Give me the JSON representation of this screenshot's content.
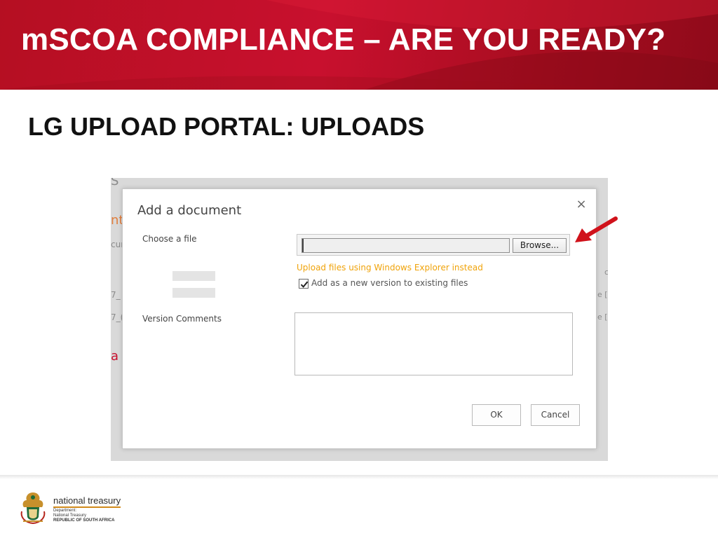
{
  "slide": {
    "title": "mSCOA COMPLIANCE – ARE YOU READY?",
    "subtitle": "LG UPLOAD PORTAL: UPLOADS"
  },
  "background_fragments": {
    "top": "S",
    "orange": "nt",
    "row1": "cur",
    "row2": "7_",
    "row3": "7_(",
    "red": "a",
    "right1": "c",
    "right2": "e [",
    "right3": "e ["
  },
  "dialog": {
    "title": "Add a document",
    "close_symbol": "×",
    "choose_file_label": "Choose a file",
    "file_input_value": "",
    "browse_label": "Browse...",
    "explorer_link": "Upload files using Windows Explorer instead",
    "version_checkbox_label": "Add as a new version to existing files",
    "version_checkbox_checked": true,
    "version_comments_label": "Version Comments",
    "version_comments_value": "",
    "ok_label": "OK",
    "cancel_label": "Cancel"
  },
  "footer": {
    "brand": "national treasury",
    "line1": "Department:",
    "line2": "National Treasury",
    "line3": "REPUBLIC OF SOUTH AFRICA"
  },
  "colors": {
    "banner_red": "#c8102e",
    "link_orange": "#f0a30a",
    "arrow_red": "#d0121b",
    "footer_gold": "#d08a1b"
  },
  "icons": {
    "close": "close-icon",
    "checkbox": "checkmark-icon",
    "pointer": "red-arrow-icon",
    "crest": "coat-of-arms-logo"
  }
}
